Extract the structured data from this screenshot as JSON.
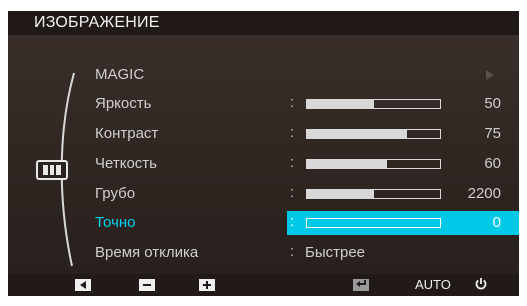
{
  "title": "ИЗОБРАЖЕНИЕ",
  "menu": {
    "items": [
      {
        "label": "MAGIC",
        "type": "submenu"
      },
      {
        "label": "Яркость",
        "value": "50",
        "level_percent": 50
      },
      {
        "label": "Контраст",
        "value": "75",
        "level_percent": 75
      },
      {
        "label": "Четкость",
        "value": "60",
        "level_percent": 60
      },
      {
        "label": "Грубо",
        "value": "2200",
        "level_percent": 50
      },
      {
        "label": "Точно",
        "value": "0",
        "level_percent": 0,
        "selected": true
      },
      {
        "label": "Время отклика",
        "text_value": "Быстрее"
      }
    ],
    "colon": ":"
  },
  "bottom": {
    "auto_label": "AUTO",
    "icons": [
      "left-arrow-icon",
      "minus-icon",
      "plus-icon",
      "enter-icon",
      "power-icon"
    ]
  },
  "colors": {
    "accent": "#00c9e8",
    "background": "#2f2622",
    "text": "#cfcfcf"
  }
}
